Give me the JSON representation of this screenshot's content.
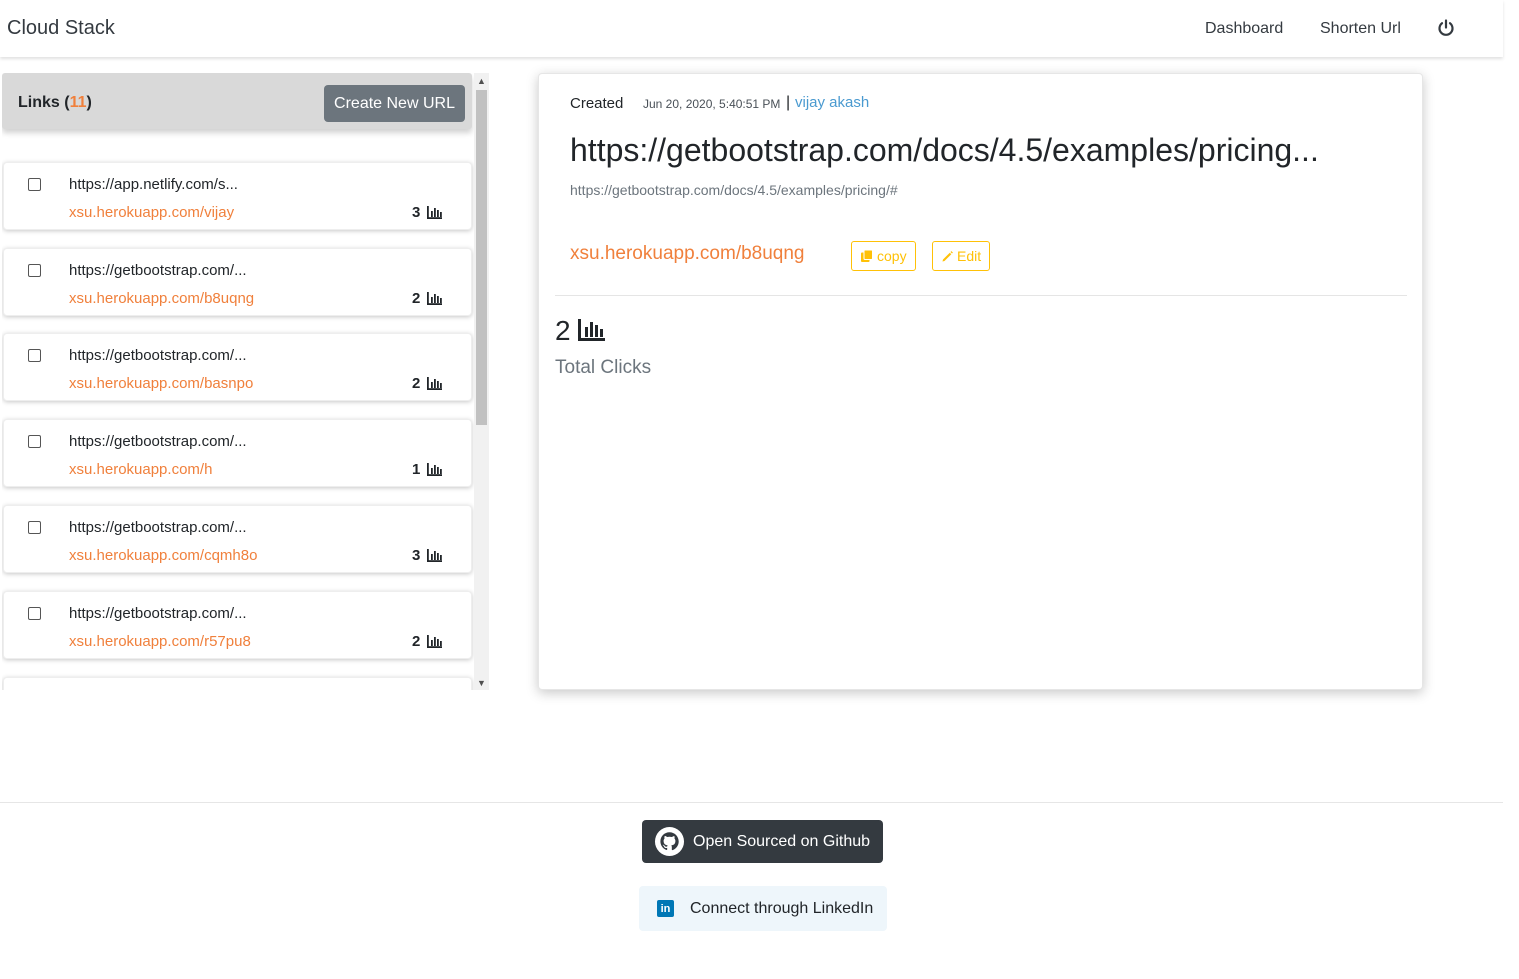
{
  "brand": "Cloud Stack",
  "nav": {
    "dashboard": "Dashboard",
    "shorten": "Shorten Url"
  },
  "sidebar": {
    "title": "Links",
    "count_open": "(",
    "count": "11",
    "count_close": ")",
    "create_label": "Create New URL",
    "links": [
      {
        "long": "https://app.netlify.com/s...",
        "short": "xsu.herokuapp.com/vijay",
        "clicks": "3"
      },
      {
        "long": "https://getbootstrap.com/...",
        "short": "xsu.herokuapp.com/b8uqng",
        "clicks": "2"
      },
      {
        "long": "https://getbootstrap.com/...",
        "short": "xsu.herokuapp.com/basnpo",
        "clicks": "2"
      },
      {
        "long": "https://getbootstrap.com/...",
        "short": "xsu.herokuapp.com/h",
        "clicks": "1"
      },
      {
        "long": "https://getbootstrap.com/...",
        "short": "xsu.herokuapp.com/cqmh8o",
        "clicks": "3"
      },
      {
        "long": "https://getbootstrap.com/...",
        "short": "xsu.herokuapp.com/r57pu8",
        "clicks": "2"
      }
    ]
  },
  "detail": {
    "created_label": "Created",
    "created_date": "Jun 20, 2020, 5:40:51 PM",
    "separator": "|",
    "user": "vijay akash",
    "title": "https://getbootstrap.com/docs/4.5/examples/pricing...",
    "full_url": "https://getbootstrap.com/docs/4.5/examples/pricing/#",
    "short_url": "xsu.herokuapp.com/b8uqng",
    "copy_label": "copy",
    "edit_label": "Edit",
    "total_clicks": "2",
    "total_label": "Total Clicks"
  },
  "footer": {
    "github_label": "Open Sourced on Github",
    "linkedin_label": "Connect through LinkedIn",
    "linkedin_badge": "in"
  },
  "colors": {
    "accent": "#f0803c",
    "link_user": "#4a9ad0",
    "warning": "#ffc107",
    "dark": "#343a40"
  }
}
